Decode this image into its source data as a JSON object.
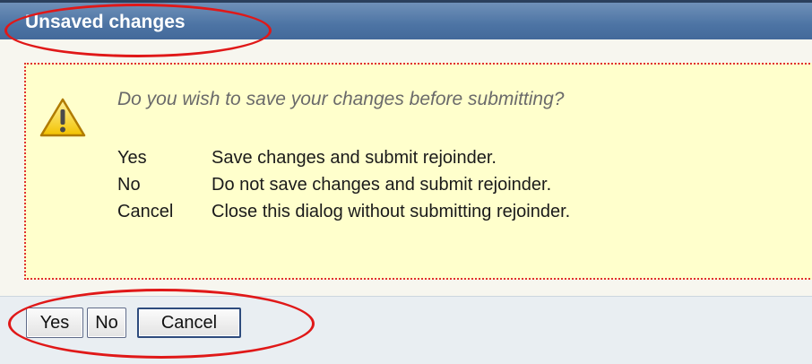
{
  "dialog": {
    "title": "Unsaved changes",
    "question": "Do you wish to save your changes before submitting?",
    "options": [
      {
        "key": "Yes",
        "description": "Save changes and submit rejoinder."
      },
      {
        "key": "No",
        "description": "Do not save changes and submit rejoinder."
      },
      {
        "key": "Cancel",
        "description": "Close this dialog without submitting rejoinder."
      }
    ],
    "icon": "warning-icon"
  },
  "buttons": {
    "yes_label": "Yes",
    "no_label": "No",
    "cancel_label": "Cancel"
  },
  "colors": {
    "titlebar": "#4d74a4",
    "message_background": "#ffffcc",
    "annotation": "#e01818"
  }
}
